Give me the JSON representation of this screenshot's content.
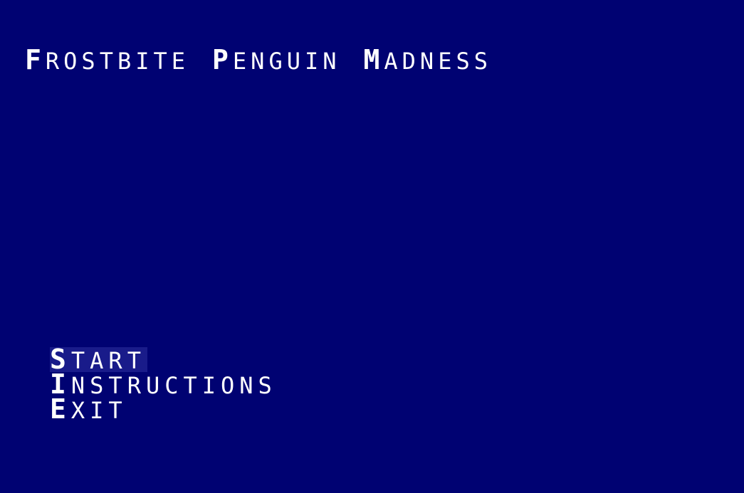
{
  "title": {
    "words": [
      {
        "cap": "F",
        "rest": "ROSTBITE"
      },
      {
        "cap": "P",
        "rest": "ENGUIN"
      },
      {
        "cap": "M",
        "rest": "ADNESS"
      }
    ]
  },
  "menu": {
    "selected_index": 0,
    "items": [
      {
        "cap": "S",
        "rest": "TART"
      },
      {
        "cap": "I",
        "rest": "NSTRUCTIONS"
      },
      {
        "cap": "E",
        "rest": "XIT"
      }
    ]
  },
  "colors": {
    "background": "#000272",
    "text": "#ffffff",
    "selection_highlight": "#191b8a"
  }
}
